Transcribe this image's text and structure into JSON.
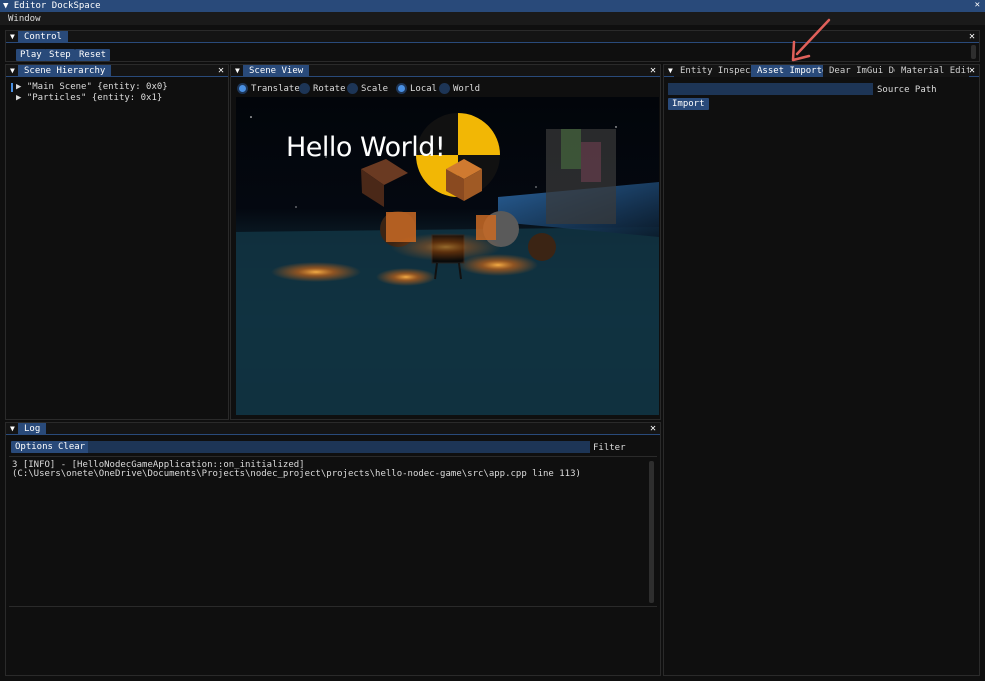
{
  "app": {
    "title": "Editor DockSpace",
    "menu_window": "Window"
  },
  "control": {
    "tab": "Control",
    "buttons": [
      "Play",
      "Step",
      "Reset"
    ]
  },
  "hierarchy": {
    "tab": "Scene Hierarchy",
    "items": [
      "\"Main Scene\" {entity: 0x0}",
      "\"Particles\" {entity: 0x1}"
    ]
  },
  "scene_view": {
    "tab": "Scene View",
    "tools": [
      "Translate",
      "Rotate",
      "Scale"
    ],
    "spaces": [
      "Local",
      "World"
    ],
    "overlay_text": "Hello World!",
    "selected_tool": "Translate",
    "selected_space": "Local"
  },
  "right_panel": {
    "tabs": [
      "Entity Inspec…",
      "Asset Importer",
      "Dear ImGui De…",
      "Material Edit…"
    ],
    "active_tab": "Asset Importer",
    "source_path_label": "Source Path",
    "source_path_value": "",
    "import_button": "Import"
  },
  "log": {
    "tab": "Log",
    "options_button": "Options",
    "clear_button": "Clear",
    "filter_label": "Filter",
    "filter_value": "",
    "lines": [
      "3    [INFO]  - [HelloNodecGameApplication::on_initialized]",
      "(C:\\Users\\onete\\OneDrive\\Documents\\Projects\\nodec_project\\projects\\hello-nodec-game\\src\\app.cpp line 113)"
    ]
  },
  "colors": {
    "accent": "#294a7a",
    "input_bg": "#1d3556",
    "radio_on": "#4a90e2"
  }
}
